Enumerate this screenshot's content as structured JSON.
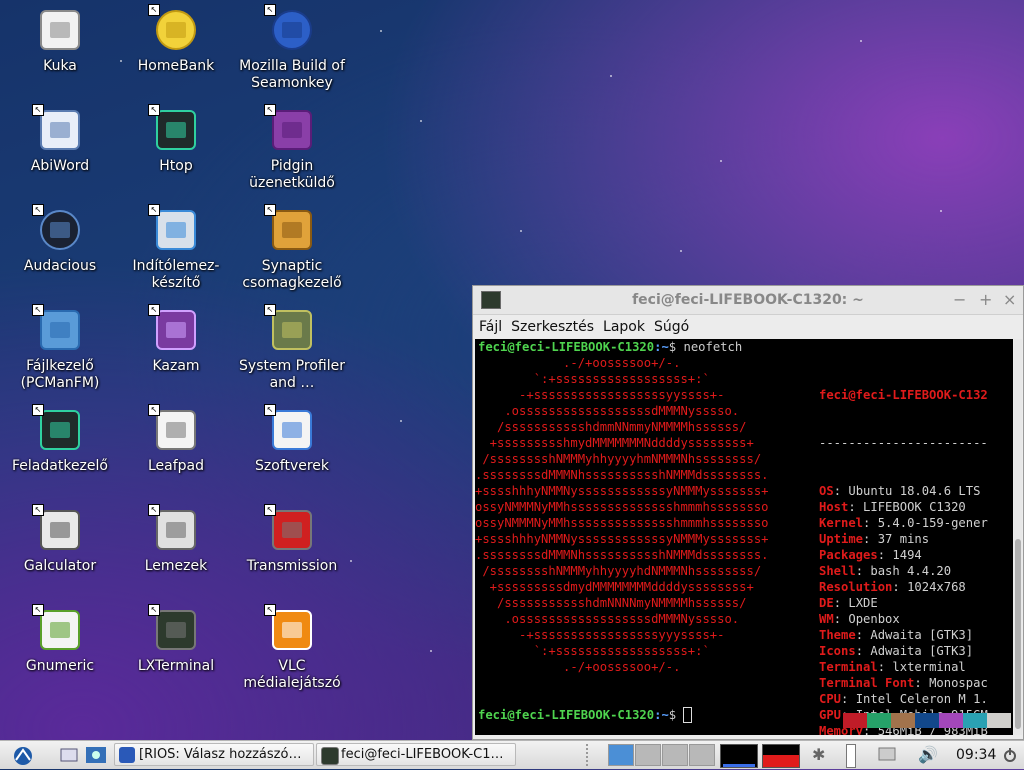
{
  "desktop_icons": [
    {
      "id": "kuka",
      "label": "Kuka",
      "icon": "trash-icon"
    },
    {
      "id": "homebank",
      "label": "HomeBank",
      "icon": "homebank-icon"
    },
    {
      "id": "seamonkey",
      "label": "Mozilla Build of Seamonkey",
      "icon": "seamonkey-icon"
    },
    {
      "id": "abiword",
      "label": "AbiWord",
      "icon": "abiword-icon"
    },
    {
      "id": "htop",
      "label": "Htop",
      "icon": "htop-icon"
    },
    {
      "id": "pidgin",
      "label": "Pidgin üzenetküldő",
      "icon": "pidgin-icon"
    },
    {
      "id": "audacious",
      "label": "Audacious",
      "icon": "audacious-icon"
    },
    {
      "id": "usb-creator",
      "label": "Indítólemez-készítő",
      "icon": "usb-creator-icon"
    },
    {
      "id": "synaptic",
      "label": "Synaptic csomagkezelő",
      "icon": "synaptic-icon"
    },
    {
      "id": "pcmanfm",
      "label": "Fájlkezelő (PCManFM)",
      "icon": "folder-icon"
    },
    {
      "id": "kazam",
      "label": "Kazam",
      "icon": "kazam-icon"
    },
    {
      "id": "hardinfo",
      "label": "System Profiler and …",
      "icon": "hardinfo-icon"
    },
    {
      "id": "taskmanager",
      "label": "Feladatkezelő",
      "icon": "task-manager-icon"
    },
    {
      "id": "leafpad",
      "label": "Leafpad",
      "icon": "leafpad-icon"
    },
    {
      "id": "software",
      "label": "Szoftverek",
      "icon": "software-center-icon"
    },
    {
      "id": "galculator",
      "label": "Galculator",
      "icon": "calculator-icon"
    },
    {
      "id": "lemezek",
      "label": "Lemezek",
      "icon": "disks-icon"
    },
    {
      "id": "transmission",
      "label": "Transmission",
      "icon": "transmission-icon"
    },
    {
      "id": "gnumeric",
      "label": "Gnumeric",
      "icon": "gnumeric-icon"
    },
    {
      "id": "lxterminal",
      "label": "LXTerminal",
      "icon": "terminal-icon"
    },
    {
      "id": "vlc",
      "label": "VLC médialejátszó",
      "icon": "vlc-icon"
    }
  ],
  "terminal": {
    "title": "feci@feci-LIFEBOOK-C1320: ~",
    "menu": [
      "Fájl",
      "Szerkesztés",
      "Lapok",
      "Súgó"
    ],
    "prompt_user": "feci@feci-LIFEBOOK-C1320",
    "prompt_path": ":~",
    "prompt_sign": "$",
    "command": " neofetch",
    "logo_lines": [
      "            .-/+oossssoo+/-.",
      "        `:+ssssssssssssssssss+:`",
      "      -+ssssssssssssssssssyyssss+-",
      "    .ossssssssssssssssssdMMMNysssso.",
      "   /ssssssssssshdmmNNmmyNMMMMhssssss/",
      "  +ssssssssshmydMMMMMMMNddddyssssssss+",
      " /sssssssshNMMMyhhyyyyhmNMMMNhssssssss/",
      ".ssssssssdMMMNhsssssssssshNMMMdssssssss.",
      "+sssshhhyNMMNyssssssssssssyNMMMysssssss+",
      "ossyNMMMNyMMhsssssssssssssshmmmhssssssso",
      "ossyNMMMNyMMhsssssssssssssshmmmhssssssso",
      "+sssshhhyNMMNyssssssssssssyNMMMysssssss+",
      ".ssssssssdMMMNhsssssssssshNMMMdssssssss.",
      " /sssssssshNMMMyhhyyyyhdNMMMNhssssssss/",
      "  +sssssssssdmydMMMMMMMMddddyssssssss+",
      "   /ssssssssssshdmNNNNmyNMMMMhssssss/",
      "    .ossssssssssssssssssdMMMNysssso.",
      "      -+sssssssssssssssssyyyssss+-",
      "        `:+ssssssssssssssssss+:`",
      "            .-/+oossssoo+/-."
    ],
    "info_header": "feci@feci-LIFEBOOK-C132",
    "info_sep": "-----------------------",
    "info": [
      {
        "k": "OS",
        "v": "Ubuntu 18.04.6 LTS"
      },
      {
        "k": "Host",
        "v": "LIFEBOOK C1320"
      },
      {
        "k": "Kernel",
        "v": "5.4.0-159-gener"
      },
      {
        "k": "Uptime",
        "v": "37 mins"
      },
      {
        "k": "Packages",
        "v": "1494"
      },
      {
        "k": "Shell",
        "v": "bash 4.4.20"
      },
      {
        "k": "Resolution",
        "v": "1024x768"
      },
      {
        "k": "DE",
        "v": "LXDE"
      },
      {
        "k": "WM",
        "v": "Openbox"
      },
      {
        "k": "Theme",
        "v": "Adwaita [GTK3]"
      },
      {
        "k": "Icons",
        "v": "Adwaita [GTK3]"
      },
      {
        "k": "Terminal",
        "v": "lxterminal"
      },
      {
        "k": "Terminal Font",
        "v": "Monospac"
      },
      {
        "k": "CPU",
        "v": "Intel Celeron M 1."
      },
      {
        "k": "GPU",
        "v": "Intel Mobile 915GM"
      },
      {
        "k": "Memory",
        "v": "546MiB / 983MiB"
      }
    ],
    "swatches": [
      "#c01c28",
      "#26a269",
      "#a2734c",
      "#12488b",
      "#a347ba",
      "#2aa1b3",
      "#d0cfcc"
    ]
  },
  "taskbar": {
    "tasks": [
      {
        "label": "[RIOS: Válasz hozzászó…",
        "icon": "seamonkey-icon"
      },
      {
        "label": "feci@feci-LIFEBOOK-C1…",
        "icon": "terminal-icon"
      }
    ],
    "clock": "09:34"
  }
}
